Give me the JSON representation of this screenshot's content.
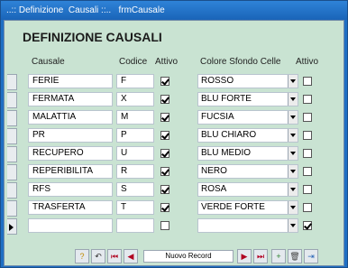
{
  "window": {
    "title": "..:: Definizione  Causali ::..   frmCausale"
  },
  "form": {
    "title": "DEFINIZIONE CAUSALI"
  },
  "headers": {
    "causale": "Causale",
    "codice": "Codice",
    "attivo_left": "Attivo",
    "colore": "Colore Sfondo Celle",
    "attivo_right": "Attivo"
  },
  "rows": [
    {
      "causale": "FERIE",
      "codice": "F",
      "attivo": true,
      "colore": "ROSSO",
      "attivo2": false
    },
    {
      "causale": "FERMATA",
      "codice": "X",
      "attivo": true,
      "colore": "BLU FORTE",
      "attivo2": false
    },
    {
      "causale": "MALATTIA",
      "codice": "M",
      "attivo": true,
      "colore": "FUCSIA",
      "attivo2": false
    },
    {
      "causale": "PR",
      "codice": "P",
      "attivo": true,
      "colore": "BLU CHIARO",
      "attivo2": false
    },
    {
      "causale": "RECUPERO",
      "codice": "U",
      "attivo": true,
      "colore": "BLU MEDIO",
      "attivo2": false
    },
    {
      "causale": "REPERIBILITA",
      "codice": "R",
      "attivo": true,
      "colore": "NERO",
      "attivo2": false
    },
    {
      "causale": "RFS",
      "codice": "S",
      "attivo": true,
      "colore": "ROSA",
      "attivo2": false
    },
    {
      "causale": "TRASFERTA",
      "codice": "T",
      "attivo": true,
      "colore": "VERDE FORTE",
      "attivo2": false
    },
    {
      "causale": "",
      "codice": "",
      "attivo": false,
      "colore": "",
      "attivo2": true
    }
  ],
  "navigation": {
    "record_label": "Nuovo Record",
    "icons": [
      "help-icon",
      "undo-icon",
      "first-record-icon",
      "previous-record-icon",
      "next-record-icon",
      "last-record-icon",
      "new-record-icon",
      "delete-icon",
      "exit-icon"
    ]
  }
}
